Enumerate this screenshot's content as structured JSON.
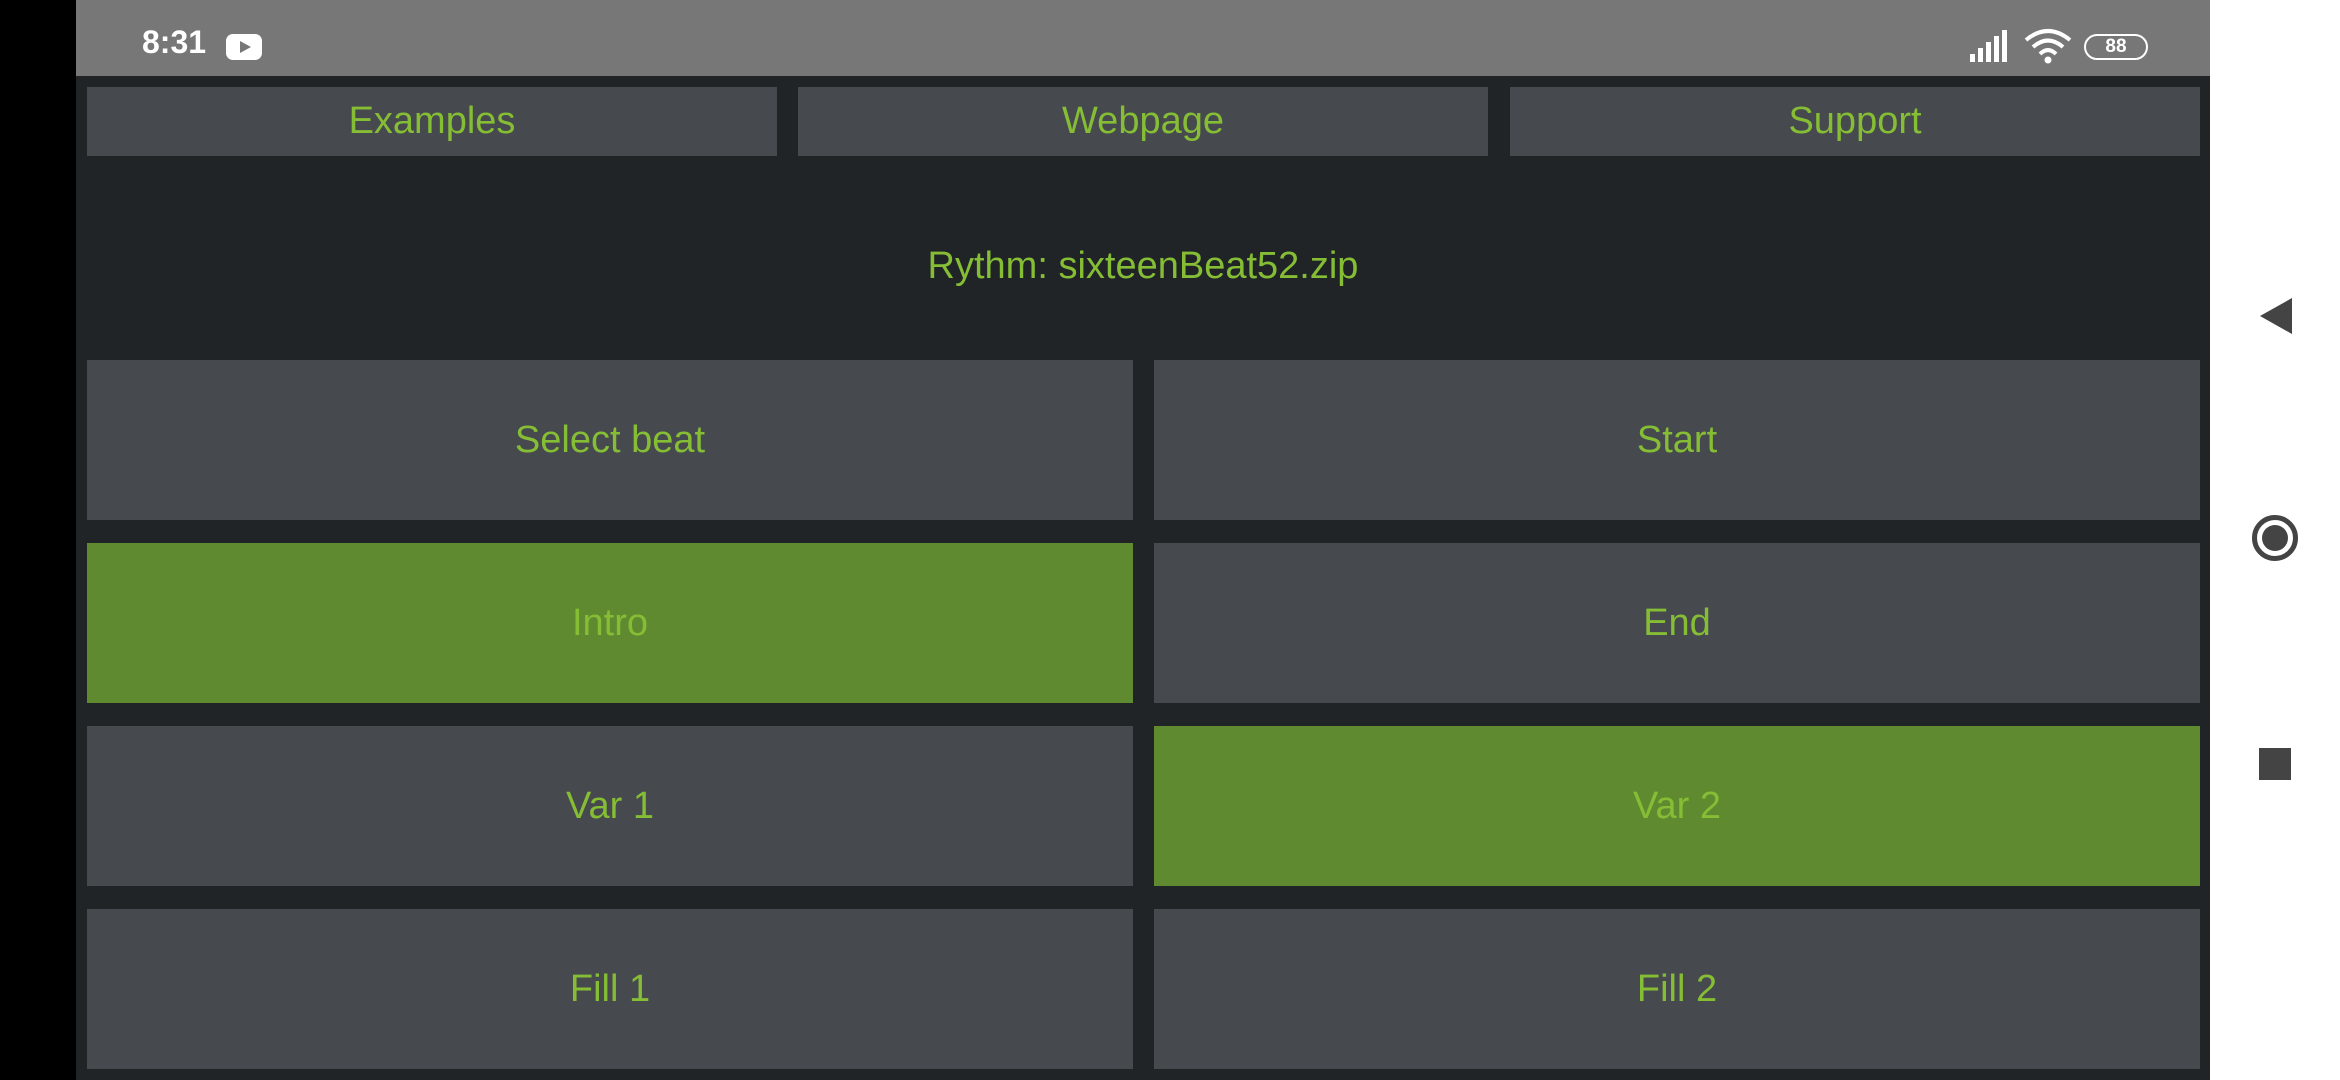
{
  "status_bar": {
    "time": "8:31",
    "battery": "88",
    "notification_icon": "youtube-icon",
    "signal_icon": "signal-icon",
    "wifi_icon": "wifi-icon"
  },
  "top_buttons": {
    "examples": "Examples",
    "webpage": "Webpage",
    "support": "Support"
  },
  "rhythm": {
    "label": "Rythm: sixteenBeat52.zip"
  },
  "controls": {
    "select_beat": "Select beat",
    "start": "Start",
    "intro": "Intro",
    "end": "End",
    "var1": "Var 1",
    "var2": "Var 2",
    "fill1": "Fill 1",
    "fill2": "Fill 2",
    "active": [
      "Intro",
      "Var 2"
    ]
  },
  "nav_bar": {
    "back_icon": "back-triangle-icon",
    "home_icon": "home-circle-icon",
    "recents_icon": "recents-square-icon"
  },
  "colors": {
    "accent_text": "#85bd35",
    "button_bg": "#46494d",
    "active_bg": "#608a30",
    "app_bg": "#212427",
    "status_bar_bg": "#777777"
  }
}
